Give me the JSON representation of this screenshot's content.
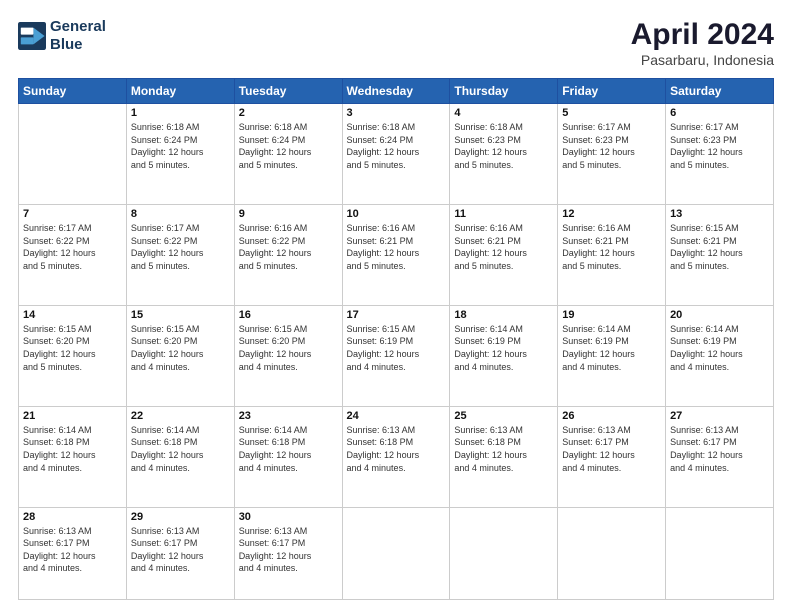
{
  "header": {
    "logo_line1": "General",
    "logo_line2": "Blue",
    "title": "April 2024",
    "subtitle": "Pasarbaru, Indonesia"
  },
  "days_of_week": [
    "Sunday",
    "Monday",
    "Tuesday",
    "Wednesday",
    "Thursday",
    "Friday",
    "Saturday"
  ],
  "weeks": [
    [
      {
        "day": "",
        "info": ""
      },
      {
        "day": "1",
        "info": "Sunrise: 6:18 AM\nSunset: 6:24 PM\nDaylight: 12 hours\nand 5 minutes."
      },
      {
        "day": "2",
        "info": "Sunrise: 6:18 AM\nSunset: 6:24 PM\nDaylight: 12 hours\nand 5 minutes."
      },
      {
        "day": "3",
        "info": "Sunrise: 6:18 AM\nSunset: 6:24 PM\nDaylight: 12 hours\nand 5 minutes."
      },
      {
        "day": "4",
        "info": "Sunrise: 6:18 AM\nSunset: 6:23 PM\nDaylight: 12 hours\nand 5 minutes."
      },
      {
        "day": "5",
        "info": "Sunrise: 6:17 AM\nSunset: 6:23 PM\nDaylight: 12 hours\nand 5 minutes."
      },
      {
        "day": "6",
        "info": "Sunrise: 6:17 AM\nSunset: 6:23 PM\nDaylight: 12 hours\nand 5 minutes."
      }
    ],
    [
      {
        "day": "7",
        "info": "Sunrise: 6:17 AM\nSunset: 6:22 PM\nDaylight: 12 hours\nand 5 minutes."
      },
      {
        "day": "8",
        "info": "Sunrise: 6:17 AM\nSunset: 6:22 PM\nDaylight: 12 hours\nand 5 minutes."
      },
      {
        "day": "9",
        "info": "Sunrise: 6:16 AM\nSunset: 6:22 PM\nDaylight: 12 hours\nand 5 minutes."
      },
      {
        "day": "10",
        "info": "Sunrise: 6:16 AM\nSunset: 6:21 PM\nDaylight: 12 hours\nand 5 minutes."
      },
      {
        "day": "11",
        "info": "Sunrise: 6:16 AM\nSunset: 6:21 PM\nDaylight: 12 hours\nand 5 minutes."
      },
      {
        "day": "12",
        "info": "Sunrise: 6:16 AM\nSunset: 6:21 PM\nDaylight: 12 hours\nand 5 minutes."
      },
      {
        "day": "13",
        "info": "Sunrise: 6:15 AM\nSunset: 6:21 PM\nDaylight: 12 hours\nand 5 minutes."
      }
    ],
    [
      {
        "day": "14",
        "info": "Sunrise: 6:15 AM\nSunset: 6:20 PM\nDaylight: 12 hours\nand 5 minutes."
      },
      {
        "day": "15",
        "info": "Sunrise: 6:15 AM\nSunset: 6:20 PM\nDaylight: 12 hours\nand 4 minutes."
      },
      {
        "day": "16",
        "info": "Sunrise: 6:15 AM\nSunset: 6:20 PM\nDaylight: 12 hours\nand 4 minutes."
      },
      {
        "day": "17",
        "info": "Sunrise: 6:15 AM\nSunset: 6:19 PM\nDaylight: 12 hours\nand 4 minutes."
      },
      {
        "day": "18",
        "info": "Sunrise: 6:14 AM\nSunset: 6:19 PM\nDaylight: 12 hours\nand 4 minutes."
      },
      {
        "day": "19",
        "info": "Sunrise: 6:14 AM\nSunset: 6:19 PM\nDaylight: 12 hours\nand 4 minutes."
      },
      {
        "day": "20",
        "info": "Sunrise: 6:14 AM\nSunset: 6:19 PM\nDaylight: 12 hours\nand 4 minutes."
      }
    ],
    [
      {
        "day": "21",
        "info": "Sunrise: 6:14 AM\nSunset: 6:18 PM\nDaylight: 12 hours\nand 4 minutes."
      },
      {
        "day": "22",
        "info": "Sunrise: 6:14 AM\nSunset: 6:18 PM\nDaylight: 12 hours\nand 4 minutes."
      },
      {
        "day": "23",
        "info": "Sunrise: 6:14 AM\nSunset: 6:18 PM\nDaylight: 12 hours\nand 4 minutes."
      },
      {
        "day": "24",
        "info": "Sunrise: 6:13 AM\nSunset: 6:18 PM\nDaylight: 12 hours\nand 4 minutes."
      },
      {
        "day": "25",
        "info": "Sunrise: 6:13 AM\nSunset: 6:18 PM\nDaylight: 12 hours\nand 4 minutes."
      },
      {
        "day": "26",
        "info": "Sunrise: 6:13 AM\nSunset: 6:17 PM\nDaylight: 12 hours\nand 4 minutes."
      },
      {
        "day": "27",
        "info": "Sunrise: 6:13 AM\nSunset: 6:17 PM\nDaylight: 12 hours\nand 4 minutes."
      }
    ],
    [
      {
        "day": "28",
        "info": "Sunrise: 6:13 AM\nSunset: 6:17 PM\nDaylight: 12 hours\nand 4 minutes."
      },
      {
        "day": "29",
        "info": "Sunrise: 6:13 AM\nSunset: 6:17 PM\nDaylight: 12 hours\nand 4 minutes."
      },
      {
        "day": "30",
        "info": "Sunrise: 6:13 AM\nSunset: 6:17 PM\nDaylight: 12 hours\nand 4 minutes."
      },
      {
        "day": "",
        "info": ""
      },
      {
        "day": "",
        "info": ""
      },
      {
        "day": "",
        "info": ""
      },
      {
        "day": "",
        "info": ""
      }
    ]
  ]
}
